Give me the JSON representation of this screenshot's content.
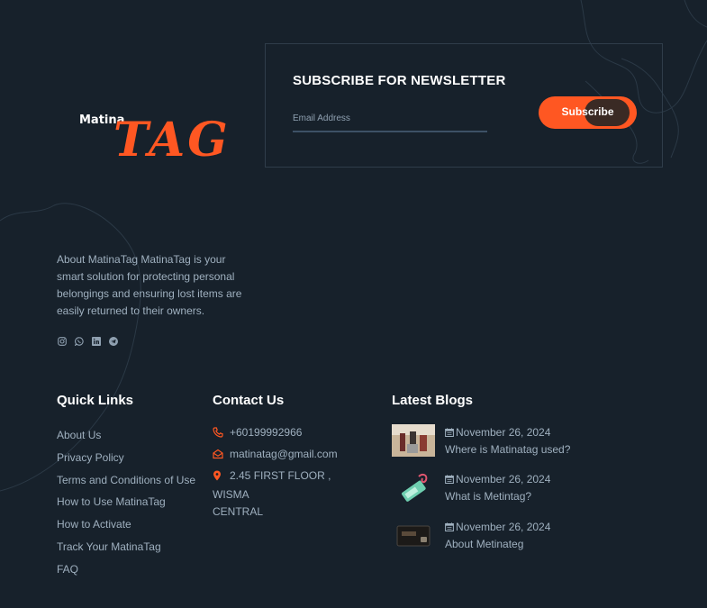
{
  "brand": {
    "logo_small": "Matina",
    "logo_big": "TAG",
    "accent_color": "#ff5722"
  },
  "newsletter": {
    "title": "SUBSCRIBE FOR NEWSLETTER",
    "email_placeholder": "Email Address",
    "email_value": "",
    "button_label": "Subscribe"
  },
  "about": {
    "text": "About MatinaTag MatinaTag is your smart solution for protecting personal belongings and ensuring lost items are easily returned to their owners."
  },
  "social_icons": [
    "instagram-icon",
    "whatsapp-icon",
    "linkedin-icon",
    "telegram-icon"
  ],
  "quick_links": {
    "title": "Quick Links",
    "items": [
      "About Us",
      "Privacy Policy",
      "Terms and Conditions of Use",
      "How to Use MatinaTag",
      "How to Activate",
      "Track Your MatinaTag",
      "FAQ"
    ]
  },
  "contact": {
    "title": "Contact Us",
    "phone": "+60199992966",
    "email": "matinatag@gmail.com",
    "address_line1": "2.45 FIRST FLOOR , WISMA",
    "address_line2": "CENTRAL"
  },
  "blogs": {
    "title": "Latest Blogs",
    "items": [
      {
        "date": "November 26, 2024",
        "title": "Where is Matinatag used?"
      },
      {
        "date": "November 26, 2024",
        "title": "What is Metintag?"
      },
      {
        "date": "November 26, 2024",
        "title": "About Metinateg"
      }
    ]
  }
}
